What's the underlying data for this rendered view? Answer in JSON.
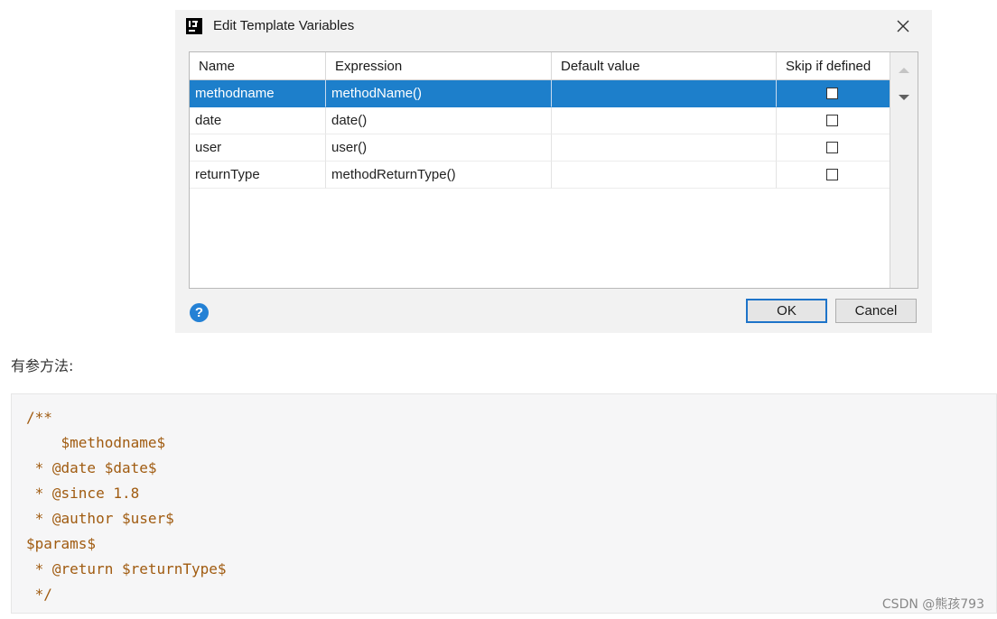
{
  "dialog": {
    "title": "Edit Template Variables",
    "close_label": "close",
    "table": {
      "headers": [
        "Name",
        "Expression",
        "Default value",
        "Skip if defined"
      ],
      "rows": [
        {
          "name": "methodname",
          "expression": "methodName()",
          "default_value": "",
          "skip_if_defined": false,
          "selected": true
        },
        {
          "name": "date",
          "expression": "date()",
          "default_value": "",
          "skip_if_defined": false,
          "selected": false
        },
        {
          "name": "user",
          "expression": "user()",
          "default_value": "",
          "skip_if_defined": false,
          "selected": false
        },
        {
          "name": "returnType",
          "expression": "methodReturnType()",
          "default_value": "",
          "skip_if_defined": false,
          "selected": false
        }
      ]
    },
    "help_label": "?",
    "ok_label": "OK",
    "cancel_label": "Cancel"
  },
  "caption": "有参方法:",
  "code_lines": [
    "/**",
    "    $methodname$",
    " * @date $date$",
    " * @since 1.8",
    " * @author $user$",
    "$params$",
    " * @return $returnType$",
    " */"
  ],
  "watermark": "CSDN @熊孩793",
  "colors": {
    "selection": "#1d7fcb",
    "code_text": "#a05b10",
    "help_icon": "#2481d5",
    "ok_border": "#1e74c9"
  }
}
